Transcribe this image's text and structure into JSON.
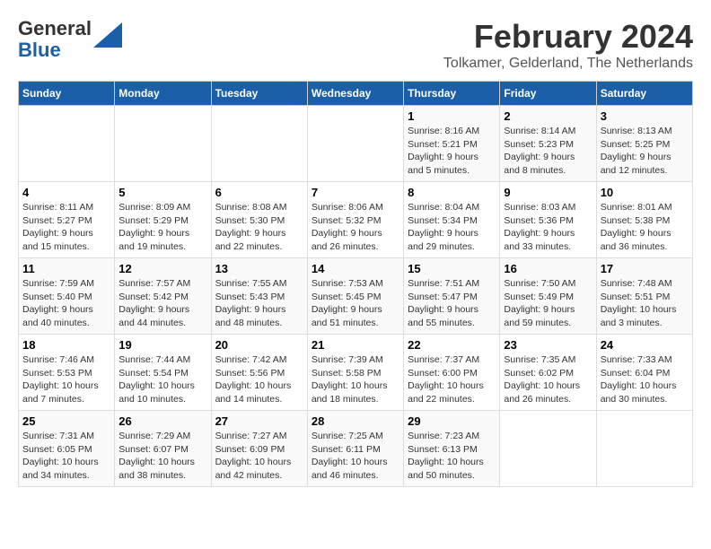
{
  "logo": {
    "line1": "General",
    "line2": "Blue"
  },
  "title": "February 2024",
  "subtitle": "Tolkamer, Gelderland, The Netherlands",
  "headers": [
    "Sunday",
    "Monday",
    "Tuesday",
    "Wednesday",
    "Thursday",
    "Friday",
    "Saturday"
  ],
  "weeks": [
    [
      {
        "day": "",
        "detail": ""
      },
      {
        "day": "",
        "detail": ""
      },
      {
        "day": "",
        "detail": ""
      },
      {
        "day": "",
        "detail": ""
      },
      {
        "day": "1",
        "detail": "Sunrise: 8:16 AM\nSunset: 5:21 PM\nDaylight: 9 hours\nand 5 minutes."
      },
      {
        "day": "2",
        "detail": "Sunrise: 8:14 AM\nSunset: 5:23 PM\nDaylight: 9 hours\nand 8 minutes."
      },
      {
        "day": "3",
        "detail": "Sunrise: 8:13 AM\nSunset: 5:25 PM\nDaylight: 9 hours\nand 12 minutes."
      }
    ],
    [
      {
        "day": "4",
        "detail": "Sunrise: 8:11 AM\nSunset: 5:27 PM\nDaylight: 9 hours\nand 15 minutes."
      },
      {
        "day": "5",
        "detail": "Sunrise: 8:09 AM\nSunset: 5:29 PM\nDaylight: 9 hours\nand 19 minutes."
      },
      {
        "day": "6",
        "detail": "Sunrise: 8:08 AM\nSunset: 5:30 PM\nDaylight: 9 hours\nand 22 minutes."
      },
      {
        "day": "7",
        "detail": "Sunrise: 8:06 AM\nSunset: 5:32 PM\nDaylight: 9 hours\nand 26 minutes."
      },
      {
        "day": "8",
        "detail": "Sunrise: 8:04 AM\nSunset: 5:34 PM\nDaylight: 9 hours\nand 29 minutes."
      },
      {
        "day": "9",
        "detail": "Sunrise: 8:03 AM\nSunset: 5:36 PM\nDaylight: 9 hours\nand 33 minutes."
      },
      {
        "day": "10",
        "detail": "Sunrise: 8:01 AM\nSunset: 5:38 PM\nDaylight: 9 hours\nand 36 minutes."
      }
    ],
    [
      {
        "day": "11",
        "detail": "Sunrise: 7:59 AM\nSunset: 5:40 PM\nDaylight: 9 hours\nand 40 minutes."
      },
      {
        "day": "12",
        "detail": "Sunrise: 7:57 AM\nSunset: 5:42 PM\nDaylight: 9 hours\nand 44 minutes."
      },
      {
        "day": "13",
        "detail": "Sunrise: 7:55 AM\nSunset: 5:43 PM\nDaylight: 9 hours\nand 48 minutes."
      },
      {
        "day": "14",
        "detail": "Sunrise: 7:53 AM\nSunset: 5:45 PM\nDaylight: 9 hours\nand 51 minutes."
      },
      {
        "day": "15",
        "detail": "Sunrise: 7:51 AM\nSunset: 5:47 PM\nDaylight: 9 hours\nand 55 minutes."
      },
      {
        "day": "16",
        "detail": "Sunrise: 7:50 AM\nSunset: 5:49 PM\nDaylight: 9 hours\nand 59 minutes."
      },
      {
        "day": "17",
        "detail": "Sunrise: 7:48 AM\nSunset: 5:51 PM\nDaylight: 10 hours\nand 3 minutes."
      }
    ],
    [
      {
        "day": "18",
        "detail": "Sunrise: 7:46 AM\nSunset: 5:53 PM\nDaylight: 10 hours\nand 7 minutes."
      },
      {
        "day": "19",
        "detail": "Sunrise: 7:44 AM\nSunset: 5:54 PM\nDaylight: 10 hours\nand 10 minutes."
      },
      {
        "day": "20",
        "detail": "Sunrise: 7:42 AM\nSunset: 5:56 PM\nDaylight: 10 hours\nand 14 minutes."
      },
      {
        "day": "21",
        "detail": "Sunrise: 7:39 AM\nSunset: 5:58 PM\nDaylight: 10 hours\nand 18 minutes."
      },
      {
        "day": "22",
        "detail": "Sunrise: 7:37 AM\nSunset: 6:00 PM\nDaylight: 10 hours\nand 22 minutes."
      },
      {
        "day": "23",
        "detail": "Sunrise: 7:35 AM\nSunset: 6:02 PM\nDaylight: 10 hours\nand 26 minutes."
      },
      {
        "day": "24",
        "detail": "Sunrise: 7:33 AM\nSunset: 6:04 PM\nDaylight: 10 hours\nand 30 minutes."
      }
    ],
    [
      {
        "day": "25",
        "detail": "Sunrise: 7:31 AM\nSunset: 6:05 PM\nDaylight: 10 hours\nand 34 minutes."
      },
      {
        "day": "26",
        "detail": "Sunrise: 7:29 AM\nSunset: 6:07 PM\nDaylight: 10 hours\nand 38 minutes."
      },
      {
        "day": "27",
        "detail": "Sunrise: 7:27 AM\nSunset: 6:09 PM\nDaylight: 10 hours\nand 42 minutes."
      },
      {
        "day": "28",
        "detail": "Sunrise: 7:25 AM\nSunset: 6:11 PM\nDaylight: 10 hours\nand 46 minutes."
      },
      {
        "day": "29",
        "detail": "Sunrise: 7:23 AM\nSunset: 6:13 PM\nDaylight: 10 hours\nand 50 minutes."
      },
      {
        "day": "",
        "detail": ""
      },
      {
        "day": "",
        "detail": ""
      }
    ]
  ]
}
